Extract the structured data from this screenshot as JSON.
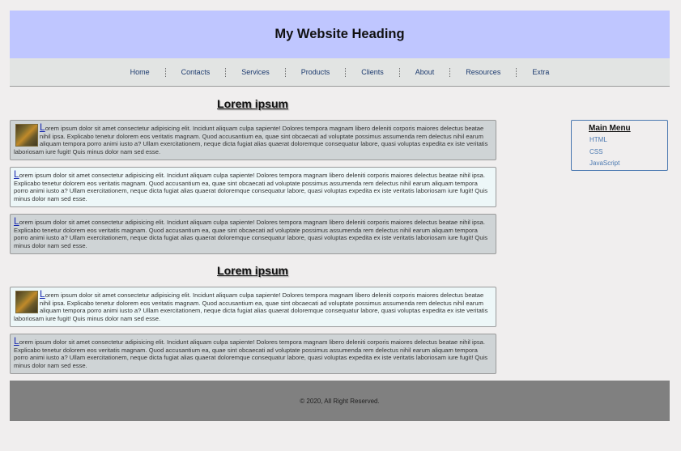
{
  "header": {
    "title": "My Website Heading"
  },
  "nav": [
    {
      "label": "Home"
    },
    {
      "label": "Contacts"
    },
    {
      "label": "Services"
    },
    {
      "label": "Products"
    },
    {
      "label": "Clients"
    },
    {
      "label": "About"
    },
    {
      "label": "Resources"
    },
    {
      "label": "Extra"
    }
  ],
  "sections": [
    {
      "title": "Lorem ipsum",
      "cards": [
        {
          "dropcap": "L",
          "text": "orem ipsum dolor sit amet consectetur adipisicing elit. Incidunt aliquam culpa sapiente! Dolores tempora magnam libero deleniti corporis maiores delectus beatae nihil ipsa. Explicabo tenetur dolorem eos veritatis magnam. Quod accusantium ea, quae sint obcaecati ad voluptate possimus assumenda rem delectus nihil earum aliquam tempora porro animi iusto a? Ullam exercitationem, neque dicta fugiat alias quaerat doloremque consequatur labore, quasi voluptas expedita ex iste veritatis laboriosam iure fugit! Quis minus dolor nam sed esse."
        },
        {
          "dropcap": "L",
          "text": "orem ipsum dolor sit amet consectetur adipisicing elit. Incidunt aliquam culpa sapiente! Dolores tempora magnam libero deleniti corporis maiores delectus beatae nihil ipsa. Explicabo tenetur dolorem eos veritatis magnam. Quod accusantium ea, quae sint obcaecati ad voluptate possimus assumenda rem delectus nihil earum aliquam tempora porro animi iusto a? Ullam exercitationem, neque dicta fugiat alias quaerat doloremque consequatur labore, quasi voluptas expedita ex iste veritatis laboriosam iure fugit! Quis minus dolor nam sed esse."
        },
        {
          "dropcap": "L",
          "text": "orem ipsum dolor sit amet consectetur adipisicing elit. Incidunt aliquam culpa sapiente! Dolores tempora magnam libero deleniti corporis maiores delectus beatae nihil ipsa. Explicabo tenetur dolorem eos veritatis magnam. Quod accusantium ea, quae sint obcaecati ad voluptate possimus assumenda rem delectus nihil earum aliquam tempora porro animi iusto a? Ullam exercitationem, neque dicta fugiat alias quaerat doloremque consequatur labore, quasi voluptas expedita ex iste veritatis laboriosam iure fugit! Quis minus dolor nam sed esse."
        }
      ]
    },
    {
      "title": "Lorem ipsum",
      "cards": [
        {
          "dropcap": "L",
          "text": "orem ipsum dolor sit amet consectetur adipisicing elit. Incidunt aliquam culpa sapiente! Dolores tempora magnam libero deleniti corporis maiores delectus beatae nihil ipsa. Explicabo tenetur dolorem eos veritatis magnam. Quod accusantium ea, quae sint obcaecati ad voluptate possimus assumenda rem delectus nihil earum aliquam tempora porro animi iusto a? Ullam exercitationem, neque dicta fugiat alias quaerat doloremque consequatur labore, quasi voluptas expedita ex iste veritatis laboriosam iure fugit! Quis minus dolor nam sed esse."
        },
        {
          "dropcap": "L",
          "text": "orem ipsum dolor sit amet consectetur adipisicing elit. Incidunt aliquam culpa sapiente! Dolores tempora magnam libero deleniti corporis maiores delectus beatae nihil ipsa. Explicabo tenetur dolorem eos veritatis magnam. Quod accusantium ea, quae sint obcaecati ad voluptate possimus assumenda rem delectus nihil earum aliquam tempora porro animi iusto a? Ullam exercitationem, neque dicta fugiat alias quaerat doloremque consequatur labore, quasi voluptas expedita ex iste veritatis laboriosam iure fugit! Quis minus dolor nam sed esse."
        }
      ]
    }
  ],
  "menu": {
    "title": "Main Menu",
    "items": [
      {
        "label": "HTML"
      },
      {
        "label": "CSS"
      },
      {
        "label": "JavaScript"
      }
    ]
  },
  "footer": {
    "text": "© 2020, All Right Reserved."
  },
  "colors": {
    "header_bg": "#bfc6ff",
    "nav_bg": "#e2e4e3",
    "card_gray": "#cfd4d6",
    "card_light": "#edf7f8",
    "footer_bg": "#808080",
    "link": "#4a78b0"
  }
}
